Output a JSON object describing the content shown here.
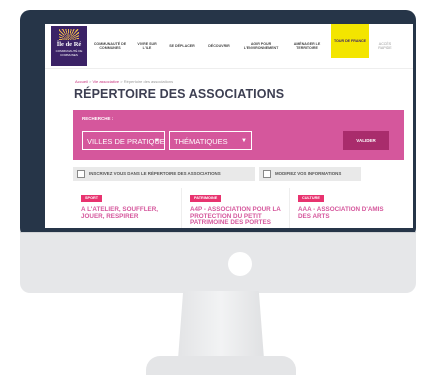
{
  "logo": {
    "name": "Île de Ré",
    "subtitle": "COMMUNAUTÉ DE COMMUNES"
  },
  "nav": {
    "items": [
      {
        "label": "COMMUNAUTÉ DE COMMUNES"
      },
      {
        "label": "VIVRE SUR L'ILE"
      },
      {
        "label": "SE DÉPLACER"
      },
      {
        "label": "DÉCOUVRIR"
      },
      {
        "label": "AGIR POUR L'ENVIRONNEMENT"
      },
      {
        "label": "AMÉNAGER LE TERRITOIRE"
      },
      {
        "label": "TOUR DE FRANCE"
      },
      {
        "label": "ACCÈS RAPIDE"
      }
    ]
  },
  "breadcrumb": {
    "home": "Accueil",
    "section": "Vie associative",
    "current": "Répertoire des associations",
    "separator": ">"
  },
  "page": {
    "title": "RÉPERTOIRE DES ASSOCIATIONS"
  },
  "search": {
    "label": "RECHERCHE :",
    "filter_city": "VILLES DE PRATIQUE",
    "filter_theme": "THÉMATIQUES",
    "submit_label": "VALIDER"
  },
  "actions": {
    "register": "INSCRIVEZ VOUS DANS LE RÉPERTOIRE DES ASSOCIATIONS",
    "modify": "MODIFIEZ VOS INFORMATIONS"
  },
  "cards": [
    {
      "tag": "SPORT",
      "title": "A L'ATELIER, SOUFFLER, JOUER, RESPIRER"
    },
    {
      "tag": "PATRIMOINE",
      "title": "A4P - ASSOCIATION POUR LA PROTECTION DU PETIT PATRIMOINE DES PORTES"
    },
    {
      "tag": "CULTURE",
      "title": "AAA - ASSOCIATION D'AMIS DES ARTS"
    }
  ],
  "colors": {
    "brand_pink": "#d5579c",
    "tag_pink": "#e8336f",
    "highlight_yellow": "#f3e500",
    "monitor_bezel": "#263548"
  },
  "icons": {
    "register": "checkbox-icon",
    "modify": "checkbox-icon",
    "select_caret": "chevron-down-icon"
  }
}
